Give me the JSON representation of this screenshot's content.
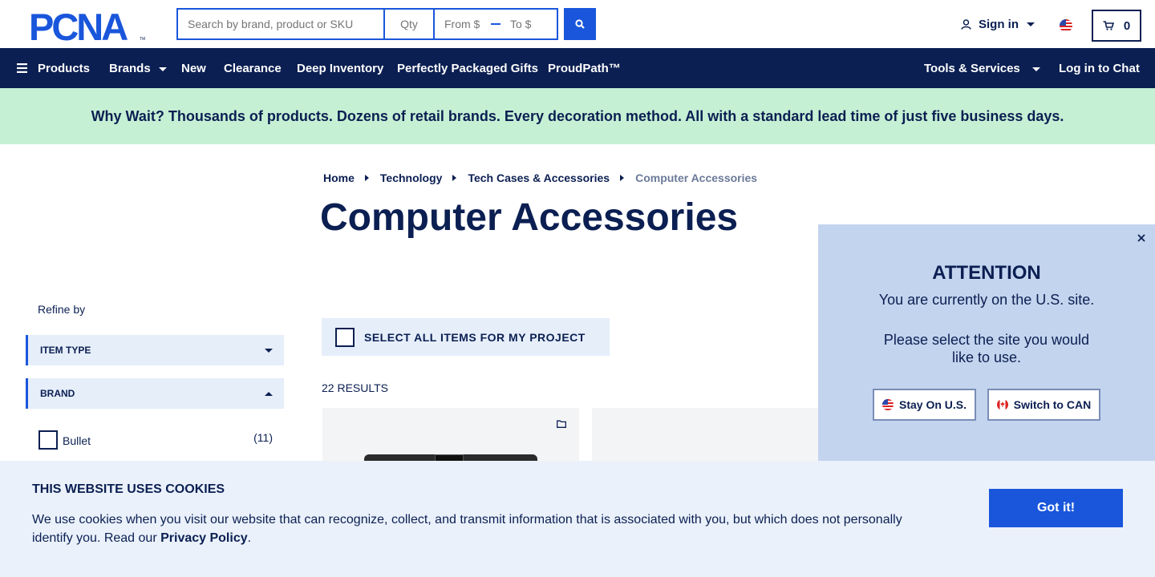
{
  "header": {
    "logo_text": "PCNA",
    "search_placeholder": "Search by brand, product or SKU",
    "qty_placeholder": "Qty",
    "from_placeholder": "From $",
    "to_placeholder": "To $",
    "sign_in_label": "Sign in",
    "cart_count": "0"
  },
  "nav": {
    "products": "Products",
    "brands": "Brands",
    "new": "New",
    "clearance": "Clearance",
    "deep_inventory": "Deep Inventory",
    "gifts": "Perfectly Packaged Gifts",
    "proudpath": "ProudPath™",
    "tools": "Tools & Services",
    "chat": "Log in to Chat"
  },
  "banner": {
    "text": "Why Wait? Thousands of products. Dozens of retail brands. Every decoration method. All with a standard lead time of just five business days."
  },
  "breadcrumb": [
    "Home",
    "Technology",
    "Tech Cases & Accessories",
    "Computer Accessories"
  ],
  "page_title": "Computer Accessories",
  "sidebar": {
    "refine_label": "Refine by",
    "facets": [
      {
        "label": "ITEM TYPE"
      },
      {
        "label": "BRAND"
      }
    ],
    "brand_options": [
      {
        "label": "Bullet",
        "count": "(11)"
      }
    ]
  },
  "main": {
    "select_all_label": "SELECT ALL ITEMS FOR MY PROJECT",
    "results_label": "22 RESULTS"
  },
  "attention": {
    "title": "ATTENTION",
    "line1": "You are currently on the U.S. site.",
    "line2": "Please select the site you would like to use.",
    "stay_label": "Stay On U.S.",
    "switch_label": "Switch to CAN"
  },
  "cookie": {
    "title": "THIS WEBSITE USES COOKIES",
    "text_before": "We use cookies when you visit our website that can recognize, collect, and transmit information that is associated with you, but which does not personally identify you. Read our ",
    "link": "Privacy Policy",
    "text_after": ".",
    "button": "Got it!"
  },
  "colors": {
    "navy": "#0b1f52",
    "blue": "#1a56db",
    "banner_green": "#c6f0d4",
    "panel_blue": "#c3d4ee"
  }
}
